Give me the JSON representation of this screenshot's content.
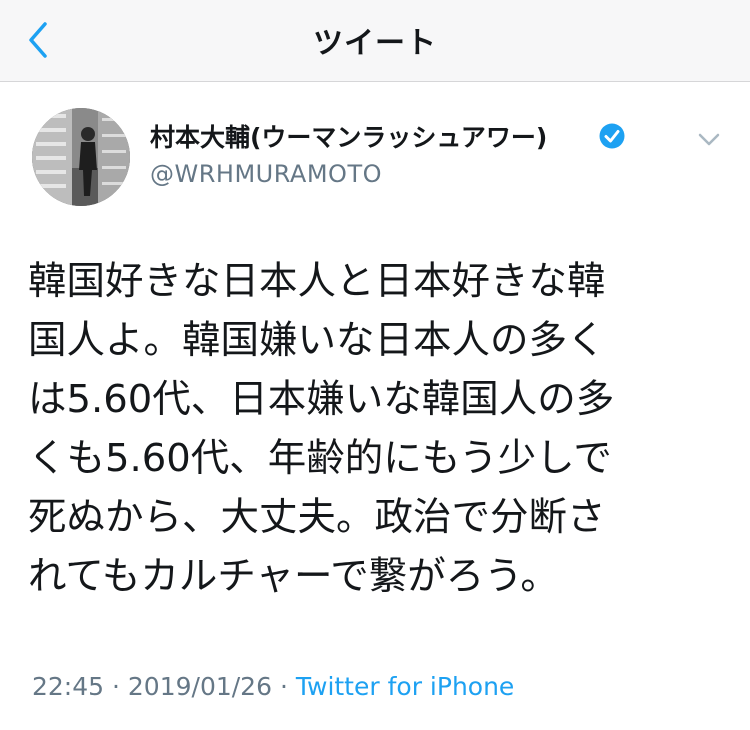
{
  "nav": {
    "title": "ツイート",
    "back_icon": "chevron-left-icon",
    "accent": "#1da1f2"
  },
  "tweet": {
    "display_name": "村本大輔(ウーマンラッシュアワー)",
    "verified_icon": "verified-badge-icon",
    "handle": "@WRHMURAMOTO",
    "lines": [
      "韓国好きな日本人と日本好きな韓",
      "国人よ。韓国嫌いな日本人の多く",
      "は5.60代、日本嫌いな韓国人の多",
      "くも5.60代、年齢的にもう少しで",
      "死ぬから、大丈夫。政治で分断さ",
      "れてもカルチャーで繋がろう。"
    ],
    "time": "22:45",
    "separator": "·",
    "date": "2019/01/26",
    "source": "Twitter for iPhone"
  }
}
